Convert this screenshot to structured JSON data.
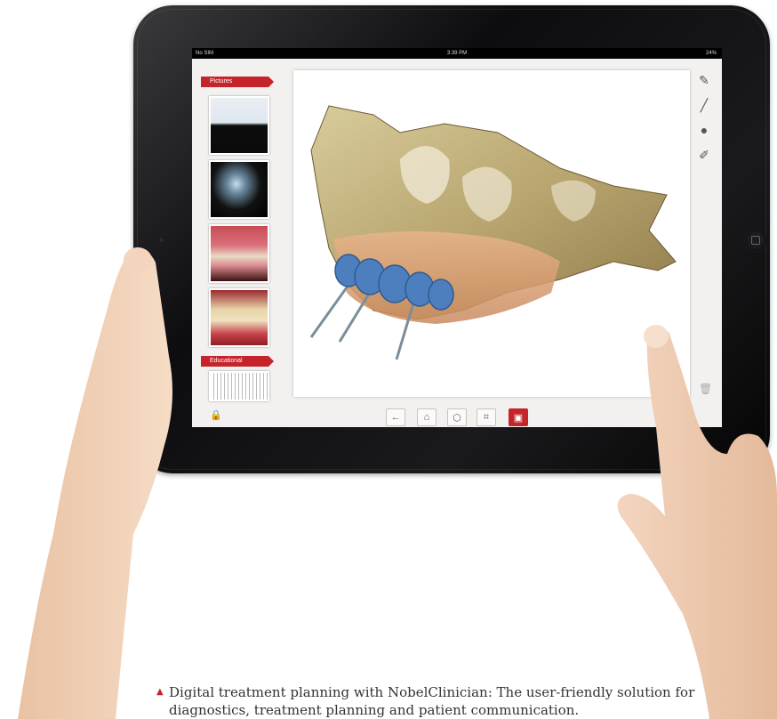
{
  "statusbar": {
    "carrier": "No SIM",
    "time": "3:39 PM",
    "battery": "24%"
  },
  "sidebar": {
    "sections": [
      {
        "label": "Pictures"
      },
      {
        "label": "Educational"
      }
    ]
  },
  "tools": [
    "pencil-icon",
    "line-icon",
    "circle-icon",
    "eraser-icon"
  ],
  "bottom_toolbar": [
    "back-icon",
    "home-icon",
    "cube-icon",
    "frame-icon",
    "image-icon"
  ],
  "caption": {
    "text": "Digital treatment planning with NobelClinician: The user-friendly solution for diagnostics, treatment planning and patient communication."
  },
  "colors": {
    "accent": "#c4242a",
    "implant_crowns": "#4d7fbf",
    "bone": "#c9b98a"
  }
}
